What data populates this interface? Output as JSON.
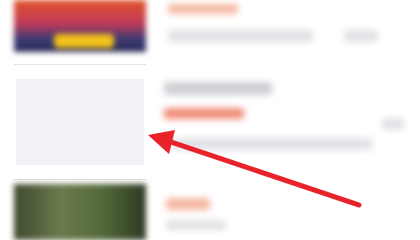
{
  "list": {
    "items": [
      {
        "thumbnail": "blurred-photo-colorful"
      },
      {
        "thumbnail": "placeholder-empty"
      },
      {
        "thumbnail": "blurred-photo-green"
      }
    ]
  },
  "annotation": {
    "arrow_color": "#e8232a",
    "points_to": "placeholder-thumbnail"
  },
  "colors": {
    "placeholder_fill": "#f1f1f6",
    "accent_text": "#f08b77"
  }
}
